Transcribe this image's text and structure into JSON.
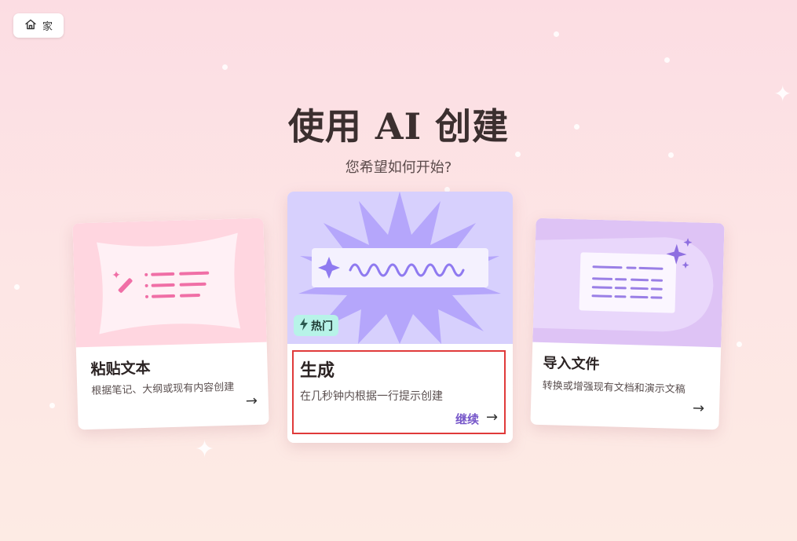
{
  "home": {
    "label": "家",
    "icon": "home-icon"
  },
  "title": "使用 AI 创建",
  "subtitle": "您希望如何开始?",
  "cards": [
    {
      "title": "粘贴文本",
      "description": "根据笔记、大纲或现有内容创建",
      "icon": "magic-wand-icon",
      "accent": "#ffd6e0"
    },
    {
      "title": "生成",
      "description": "在几秒钟内根据一行提示创建",
      "badge": "热门",
      "badge_icon": "lightning-icon",
      "action_label": "继续",
      "accent": "#d7d0fd",
      "highlight_color": "#e03a3a"
    },
    {
      "title": "导入文件",
      "description": "转换或增强现有文档和演示文稿",
      "icon": "sparkle-icon",
      "accent": "#dec3f5"
    }
  ],
  "colors": {
    "background": "#fde3e4",
    "link": "#7656c9"
  }
}
